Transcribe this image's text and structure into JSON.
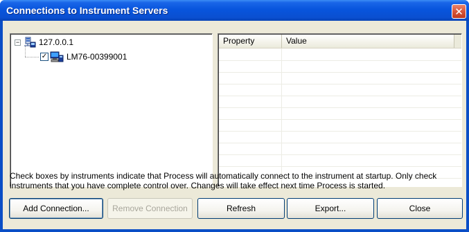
{
  "window": {
    "title": "Connections to Instrument Servers",
    "close_glyph": "✕"
  },
  "tree": {
    "server": {
      "label": "127.0.0.1",
      "expander": "−",
      "icon": "network-server-icon"
    },
    "instrument": {
      "label": "LM76-00399001",
      "checked": true,
      "check_glyph": "✓",
      "icon": "instrument-computer-icon"
    }
  },
  "properties": {
    "columns": [
      "Property",
      "Value"
    ],
    "rows": []
  },
  "info": {
    "text": "Check boxes by instruments indicate that Process will automatically connect to the instrument at startup. Only check instruments that you have complete control over. Changes will take effect next time Process is started."
  },
  "buttons": {
    "add": "Add Connection...",
    "remove": "Remove Connection",
    "refresh": "Refresh",
    "export": "Export...",
    "close": "Close"
  },
  "colors": {
    "titlebar": "#0855dd",
    "dialog_bg": "#ece9d8",
    "close_button": "#d8553a"
  }
}
